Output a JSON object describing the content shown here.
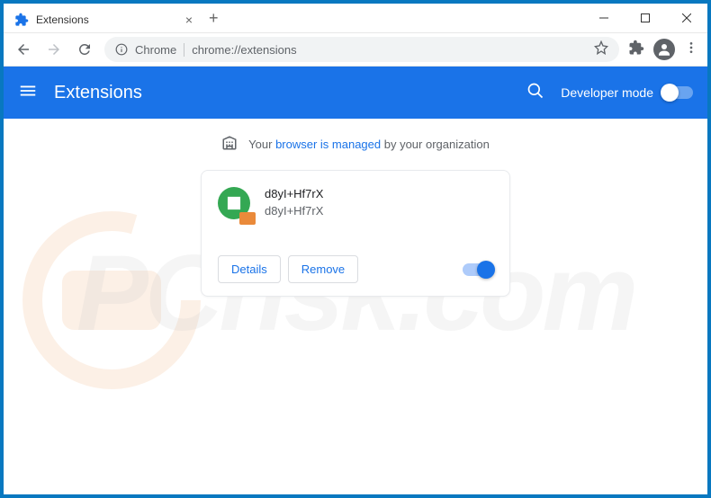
{
  "tab": {
    "title": "Extensions"
  },
  "addressbar": {
    "label": "Chrome",
    "url": "chrome://extensions"
  },
  "header": {
    "title": "Extensions",
    "dev_mode": "Developer mode"
  },
  "managed": {
    "prefix": "Your ",
    "link": "browser is managed",
    "suffix": " by your organization"
  },
  "extension": {
    "name": "d8yI+Hf7rX",
    "description": "d8yI+Hf7rX",
    "details": "Details",
    "remove": "Remove"
  },
  "watermark": "PCrisk.com"
}
